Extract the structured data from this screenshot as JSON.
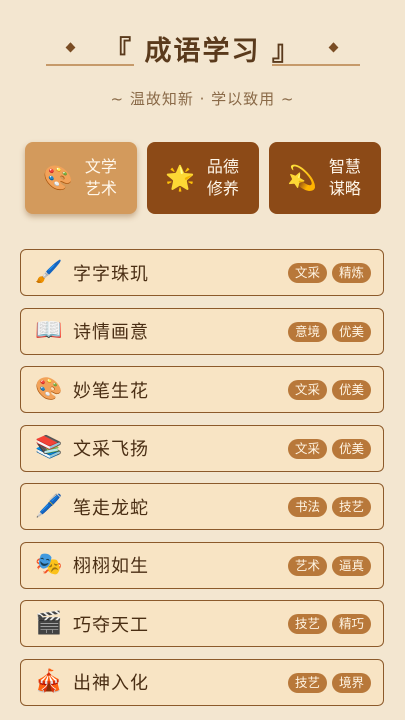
{
  "header": {
    "title": "『 成语学习 』",
    "subtitle": "~ 温故知新 · 学以致用 ~"
  },
  "categories": [
    {
      "icon": "🎨",
      "label": "文学艺术",
      "active": true
    },
    {
      "icon": "🌟",
      "label": "品德修养",
      "active": false
    },
    {
      "icon": "💫",
      "label": "智慧谋略",
      "active": false
    }
  ],
  "idioms": [
    {
      "icon": "🖌️",
      "title": "字字珠玑",
      "tags": [
        "文采",
        "精炼"
      ]
    },
    {
      "icon": "📖",
      "title": "诗情画意",
      "tags": [
        "意境",
        "优美"
      ]
    },
    {
      "icon": "🎨",
      "title": "妙笔生花",
      "tags": [
        "文采",
        "优美"
      ]
    },
    {
      "icon": "📚",
      "title": "文采飞扬",
      "tags": [
        "文采",
        "优美"
      ]
    },
    {
      "icon": "🖊️",
      "title": "笔走龙蛇",
      "tags": [
        "书法",
        "技艺"
      ]
    },
    {
      "icon": "🎭",
      "title": "栩栩如生",
      "tags": [
        "艺术",
        "逼真"
      ]
    },
    {
      "icon": "🎬",
      "title": "巧夺天工",
      "tags": [
        "技艺",
        "精巧"
      ]
    },
    {
      "icon": "🎪",
      "title": "出神入化",
      "tags": [
        "技艺",
        "境界"
      ]
    }
  ],
  "colors": {
    "background": "#fdf6ea",
    "active_category": "#d39a5c",
    "inactive_category": "#8c4a17",
    "item_background": "#f8e4c4",
    "item_border": "#8c5a2b",
    "tag": "#b8783a",
    "title_text": "#5a3a1c"
  }
}
